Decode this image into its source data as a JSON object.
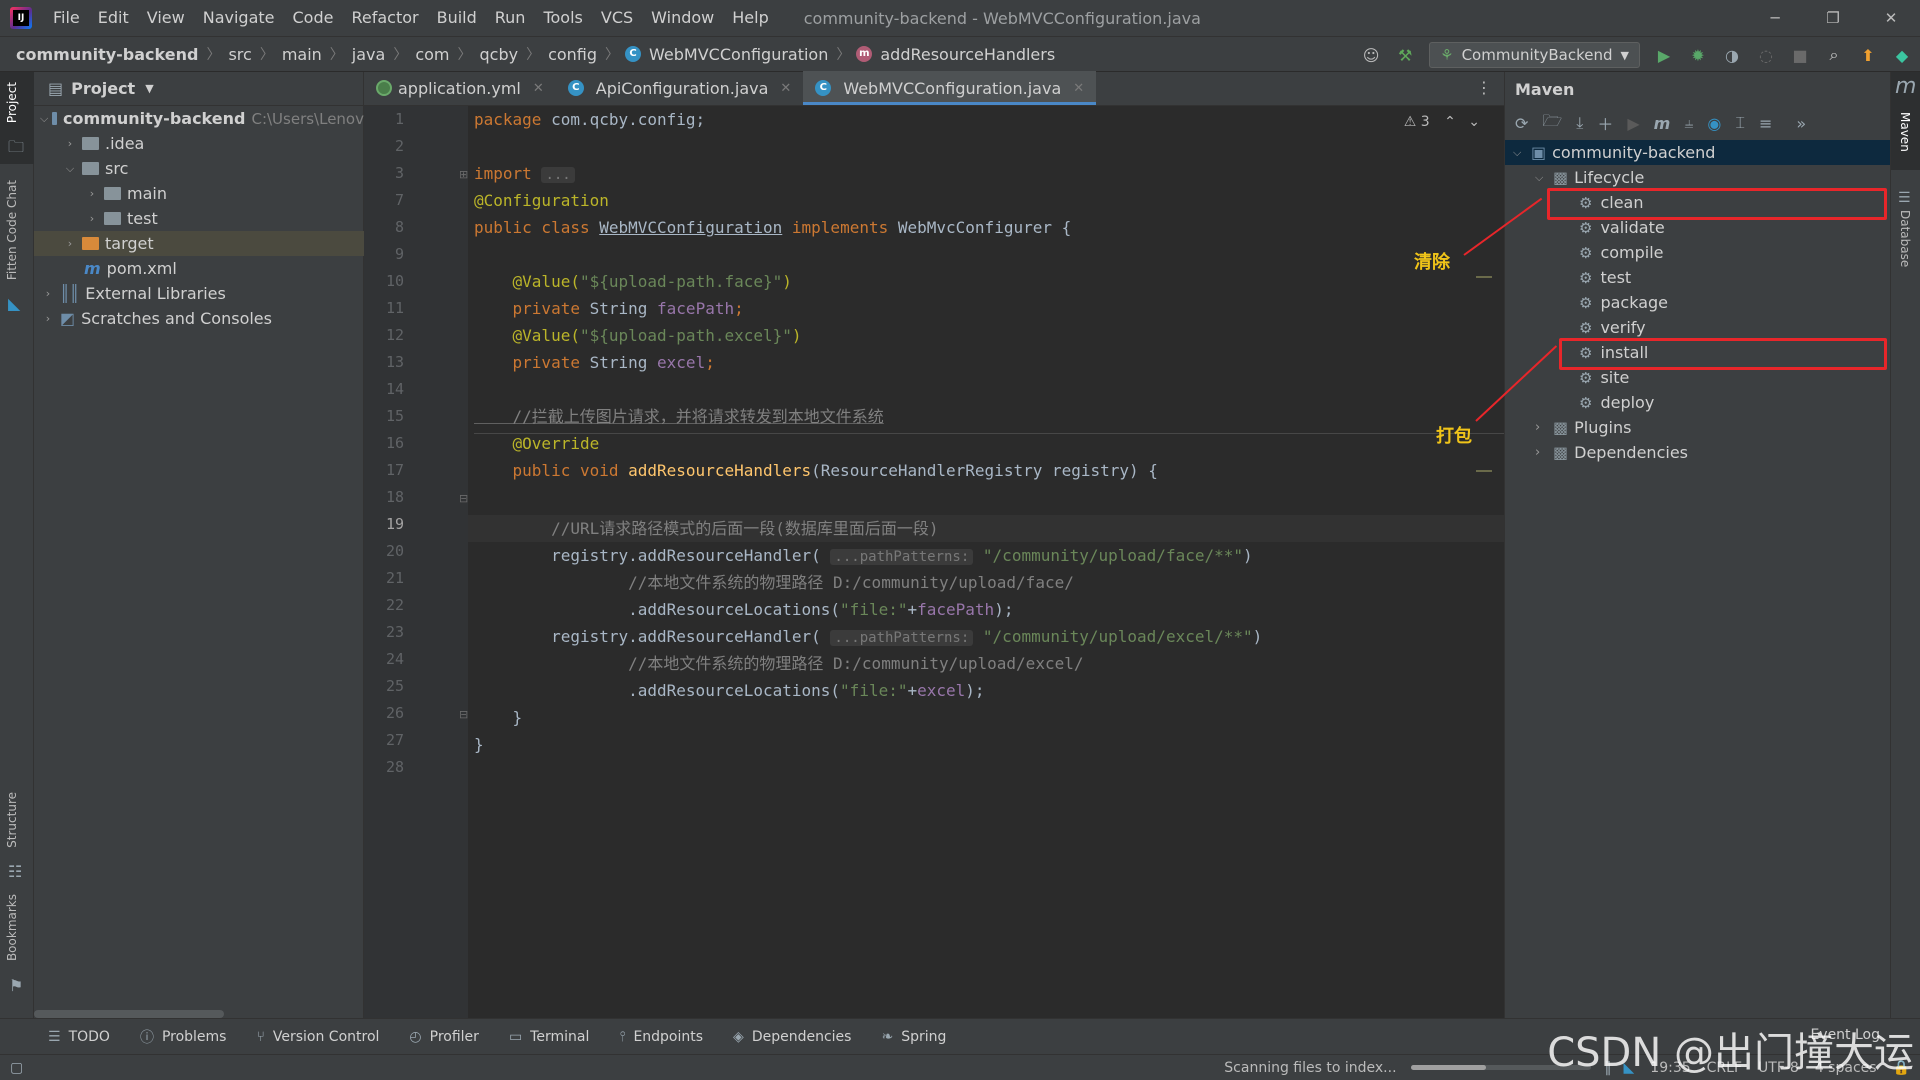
{
  "menubar": {
    "items": [
      "File",
      "Edit",
      "View",
      "Navigate",
      "Code",
      "Refactor",
      "Build",
      "Run",
      "Tools",
      "VCS",
      "Window",
      "Help"
    ],
    "title": "community-backend - WebMVCConfiguration.java"
  },
  "navbar": {
    "crumbs": [
      "community-backend",
      "src",
      "main",
      "java",
      "com",
      "qcby",
      "config",
      "WebMVCConfiguration",
      "addResourceHandlers"
    ],
    "run_config": "CommunityBackend"
  },
  "left_strip": {
    "project": "Project",
    "chat": "Fitten Code Chat",
    "structure": "Structure",
    "bookmarks": "Bookmarks"
  },
  "project": {
    "header": "Project",
    "tree": [
      {
        "label": "community-backend",
        "hint": "C:\\Users\\Lenov"
      },
      {
        "label": ".idea"
      },
      {
        "label": "src"
      },
      {
        "label": "main"
      },
      {
        "label": "test"
      },
      {
        "label": "target"
      },
      {
        "label": "pom.xml"
      },
      {
        "label": "External Libraries"
      },
      {
        "label": "Scratches and Consoles"
      }
    ]
  },
  "tabs": [
    {
      "label": "application.yml"
    },
    {
      "label": "ApiConfiguration.java"
    },
    {
      "label": "WebMVCConfiguration.java"
    }
  ],
  "editor": {
    "warnings": "3",
    "line_numbers": [
      "1",
      "2",
      "3",
      "7",
      "8",
      "9",
      "10",
      "11",
      "12",
      "13",
      "14",
      "15",
      "16",
      "17",
      "18",
      "19",
      "20",
      "21",
      "22",
      "23",
      "24",
      "25",
      "26",
      "27",
      "28"
    ],
    "current_line": "19",
    "lines": {
      "l1a": "package ",
      "l1b": "com.qcby.config;",
      "l3a": "import ",
      "l3b": "...",
      "l7": "@Configuration",
      "l8a": "public class ",
      "l8b": "WebMVCConfiguration",
      "l8c": " implements ",
      "l8d": "WebMvcConfigurer {",
      "l11a": "    @Value(",
      "l11b": "\"${upload-path.face}\"",
      "l11c": ")",
      "l12a": "    private ",
      "l12b": "String ",
      "l12c": "facePath",
      ";": ";",
      "l13a": "    @Value(",
      "l13b": "\"${upload-path.excel}\"",
      "l13c": ")",
      "l14a": "    private ",
      "l14b": "String ",
      "l14c": "excel",
      "l16": "    //拦截上传图片请求，并将请求转发到本地文件系统",
      "l17": "    @Override",
      "l18a": "    public void ",
      "l18b": "addResourceHandlers",
      "l18c": "(ResourceHandlerRegistry registry) {",
      "l19": "        //URL请求路径模式的后面一段(数据库里面后面一段)",
      "l20a": "        registry.addResourceHandler( ",
      "l20h": "...pathPatterns:",
      "l20b": " \"/community/upload/face/**\"",
      "l20c": ")",
      "l21": "                //本地文件系统的物理路径 D:/community/upload/face/",
      "l22a": "                .addResourceLocations(",
      "l22b": "\"file:\"",
      "l22c": "+",
      "l22d": "facePath",
      ");": ");",
      "l23a": "        registry.addResourceHandler( ",
      "l23h": "...pathPatterns:",
      "l23b": " \"/community/upload/excel/**\"",
      "l23c": ")",
      "l24": "                //本地文件系统的物理路径 D:/community/upload/excel/",
      "l25a": "                .addResourceLocations(",
      "l25b": "\"file:\"",
      "l25c": "+",
      "l25d": "excel",
      "l26": "    }",
      "l27": "}"
    }
  },
  "maven": {
    "header": "Maven",
    "project": "community-backend",
    "lifecycle": "Lifecycle",
    "goals": [
      "clean",
      "validate",
      "compile",
      "test",
      "package",
      "verify",
      "install",
      "site",
      "deploy"
    ],
    "plugins": "Plugins",
    "dependencies": "Dependencies",
    "annotation_clean": "清除",
    "annotation_install": "打包"
  },
  "right_strip": {
    "maven": "Maven",
    "database": "Database"
  },
  "toolwindows": [
    "TODO",
    "Problems",
    "Version Control",
    "Profiler",
    "Terminal",
    "Endpoints",
    "Dependencies",
    "Spring"
  ],
  "status": {
    "message": "Scanning files to index...",
    "progress": 0.42,
    "time": "19:35",
    "line_sep": "CRLF",
    "encoding": "UTF-8",
    "indent": "4 spaces",
    "event_log": "Event Log"
  },
  "watermark": "CSDN @出门撞大运",
  "colors": {
    "accent": "#4a88c7",
    "highlight": "#e8262a",
    "annotation": "#f0c419"
  }
}
